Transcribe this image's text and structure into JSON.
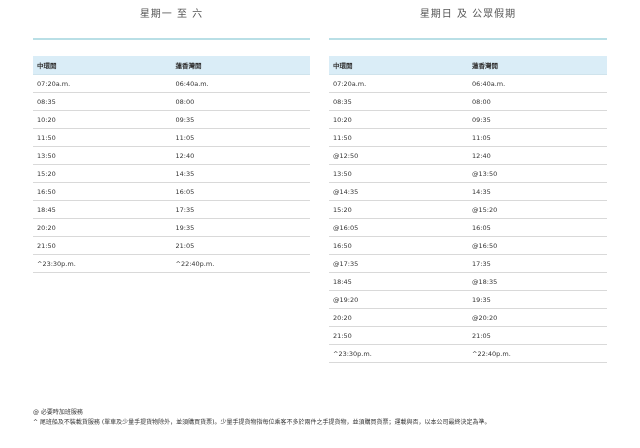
{
  "left": {
    "title": "星期一 至 六",
    "headers": [
      "中環開",
      "蓮香灣開"
    ],
    "rows": [
      [
        "07:20a.m.",
        "06:40a.m."
      ],
      [
        "08:35",
        "08:00"
      ],
      [
        "10:20",
        "09:35"
      ],
      [
        "11:50",
        "11:05"
      ],
      [
        "13:50",
        "12:40"
      ],
      [
        "15:20",
        "14:35"
      ],
      [
        "16:50",
        "16:05"
      ],
      [
        "18:45",
        "17:35"
      ],
      [
        "20:20",
        "19:35"
      ],
      [
        "21:50",
        "21:05"
      ],
      [
        "^23:30p.m.",
        "^22:40p.m."
      ]
    ]
  },
  "right": {
    "title": "星期日 及 公眾假期",
    "headers": [
      "中環開",
      "蓮香灣開"
    ],
    "rows": [
      [
        "07:20a.m.",
        "06:40a.m."
      ],
      [
        "08:35",
        "08:00"
      ],
      [
        "10:20",
        "09:35"
      ],
      [
        "11:50",
        "11:05"
      ],
      [
        "@12:50",
        "12:40"
      ],
      [
        "13:50",
        "@13:50"
      ],
      [
        "@14:35",
        "14:35"
      ],
      [
        "15:20",
        "@15:20"
      ],
      [
        "@16:05",
        "16:05"
      ],
      [
        "16:50",
        "@16:50"
      ],
      [
        "@17:35",
        "17:35"
      ],
      [
        "18:45",
        "@18:35"
      ],
      [
        "@19:20",
        "19:35"
      ],
      [
        "20:20",
        "@20:20"
      ],
      [
        "21:50",
        "21:05"
      ],
      [
        "^23:30p.m.",
        "^22:40p.m."
      ]
    ]
  },
  "footnotes": [
    "@ 必要時加班服務",
    "^ 尾班船及不裝載貨服務 (單車及少量手提貨物除外，並須購買貨票)。少量手提貨物指每位乘客不多於兩件之手提貨物，並須購買貨票；運載與否，以本公司最終決定為準。"
  ]
}
